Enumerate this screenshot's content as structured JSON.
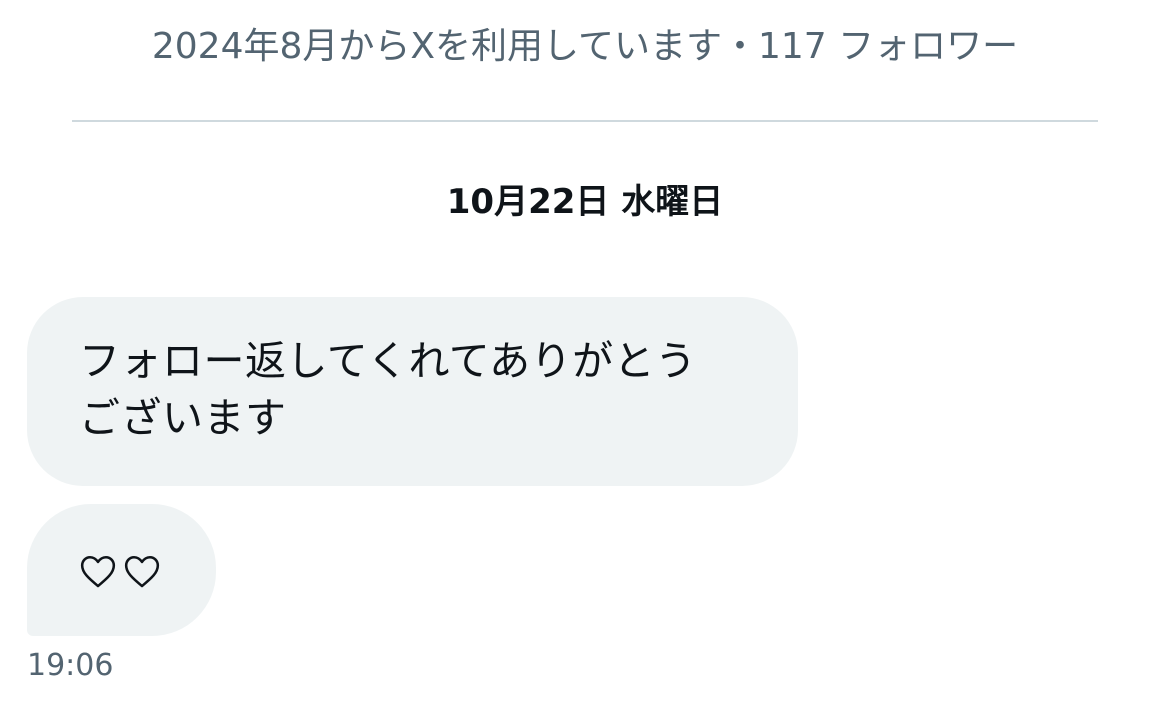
{
  "profile": {
    "meta": "2024年8月からXを利用しています・117 フォロワー"
  },
  "conversation": {
    "date_separator": "10月22日 水曜日",
    "messages": [
      {
        "text_line1": "フォロー返してくれてありがとう",
        "text_line2": "ございます"
      },
      {
        "content": "♡♡",
        "icons": [
          "heart-outline-icon",
          "heart-outline-icon"
        ]
      }
    ],
    "timestamp": "19:06"
  },
  "colors": {
    "bubble_background": "#eff3f4",
    "secondary_text": "#536471",
    "primary_text": "#0f1419",
    "divider": "#cfd9de"
  }
}
